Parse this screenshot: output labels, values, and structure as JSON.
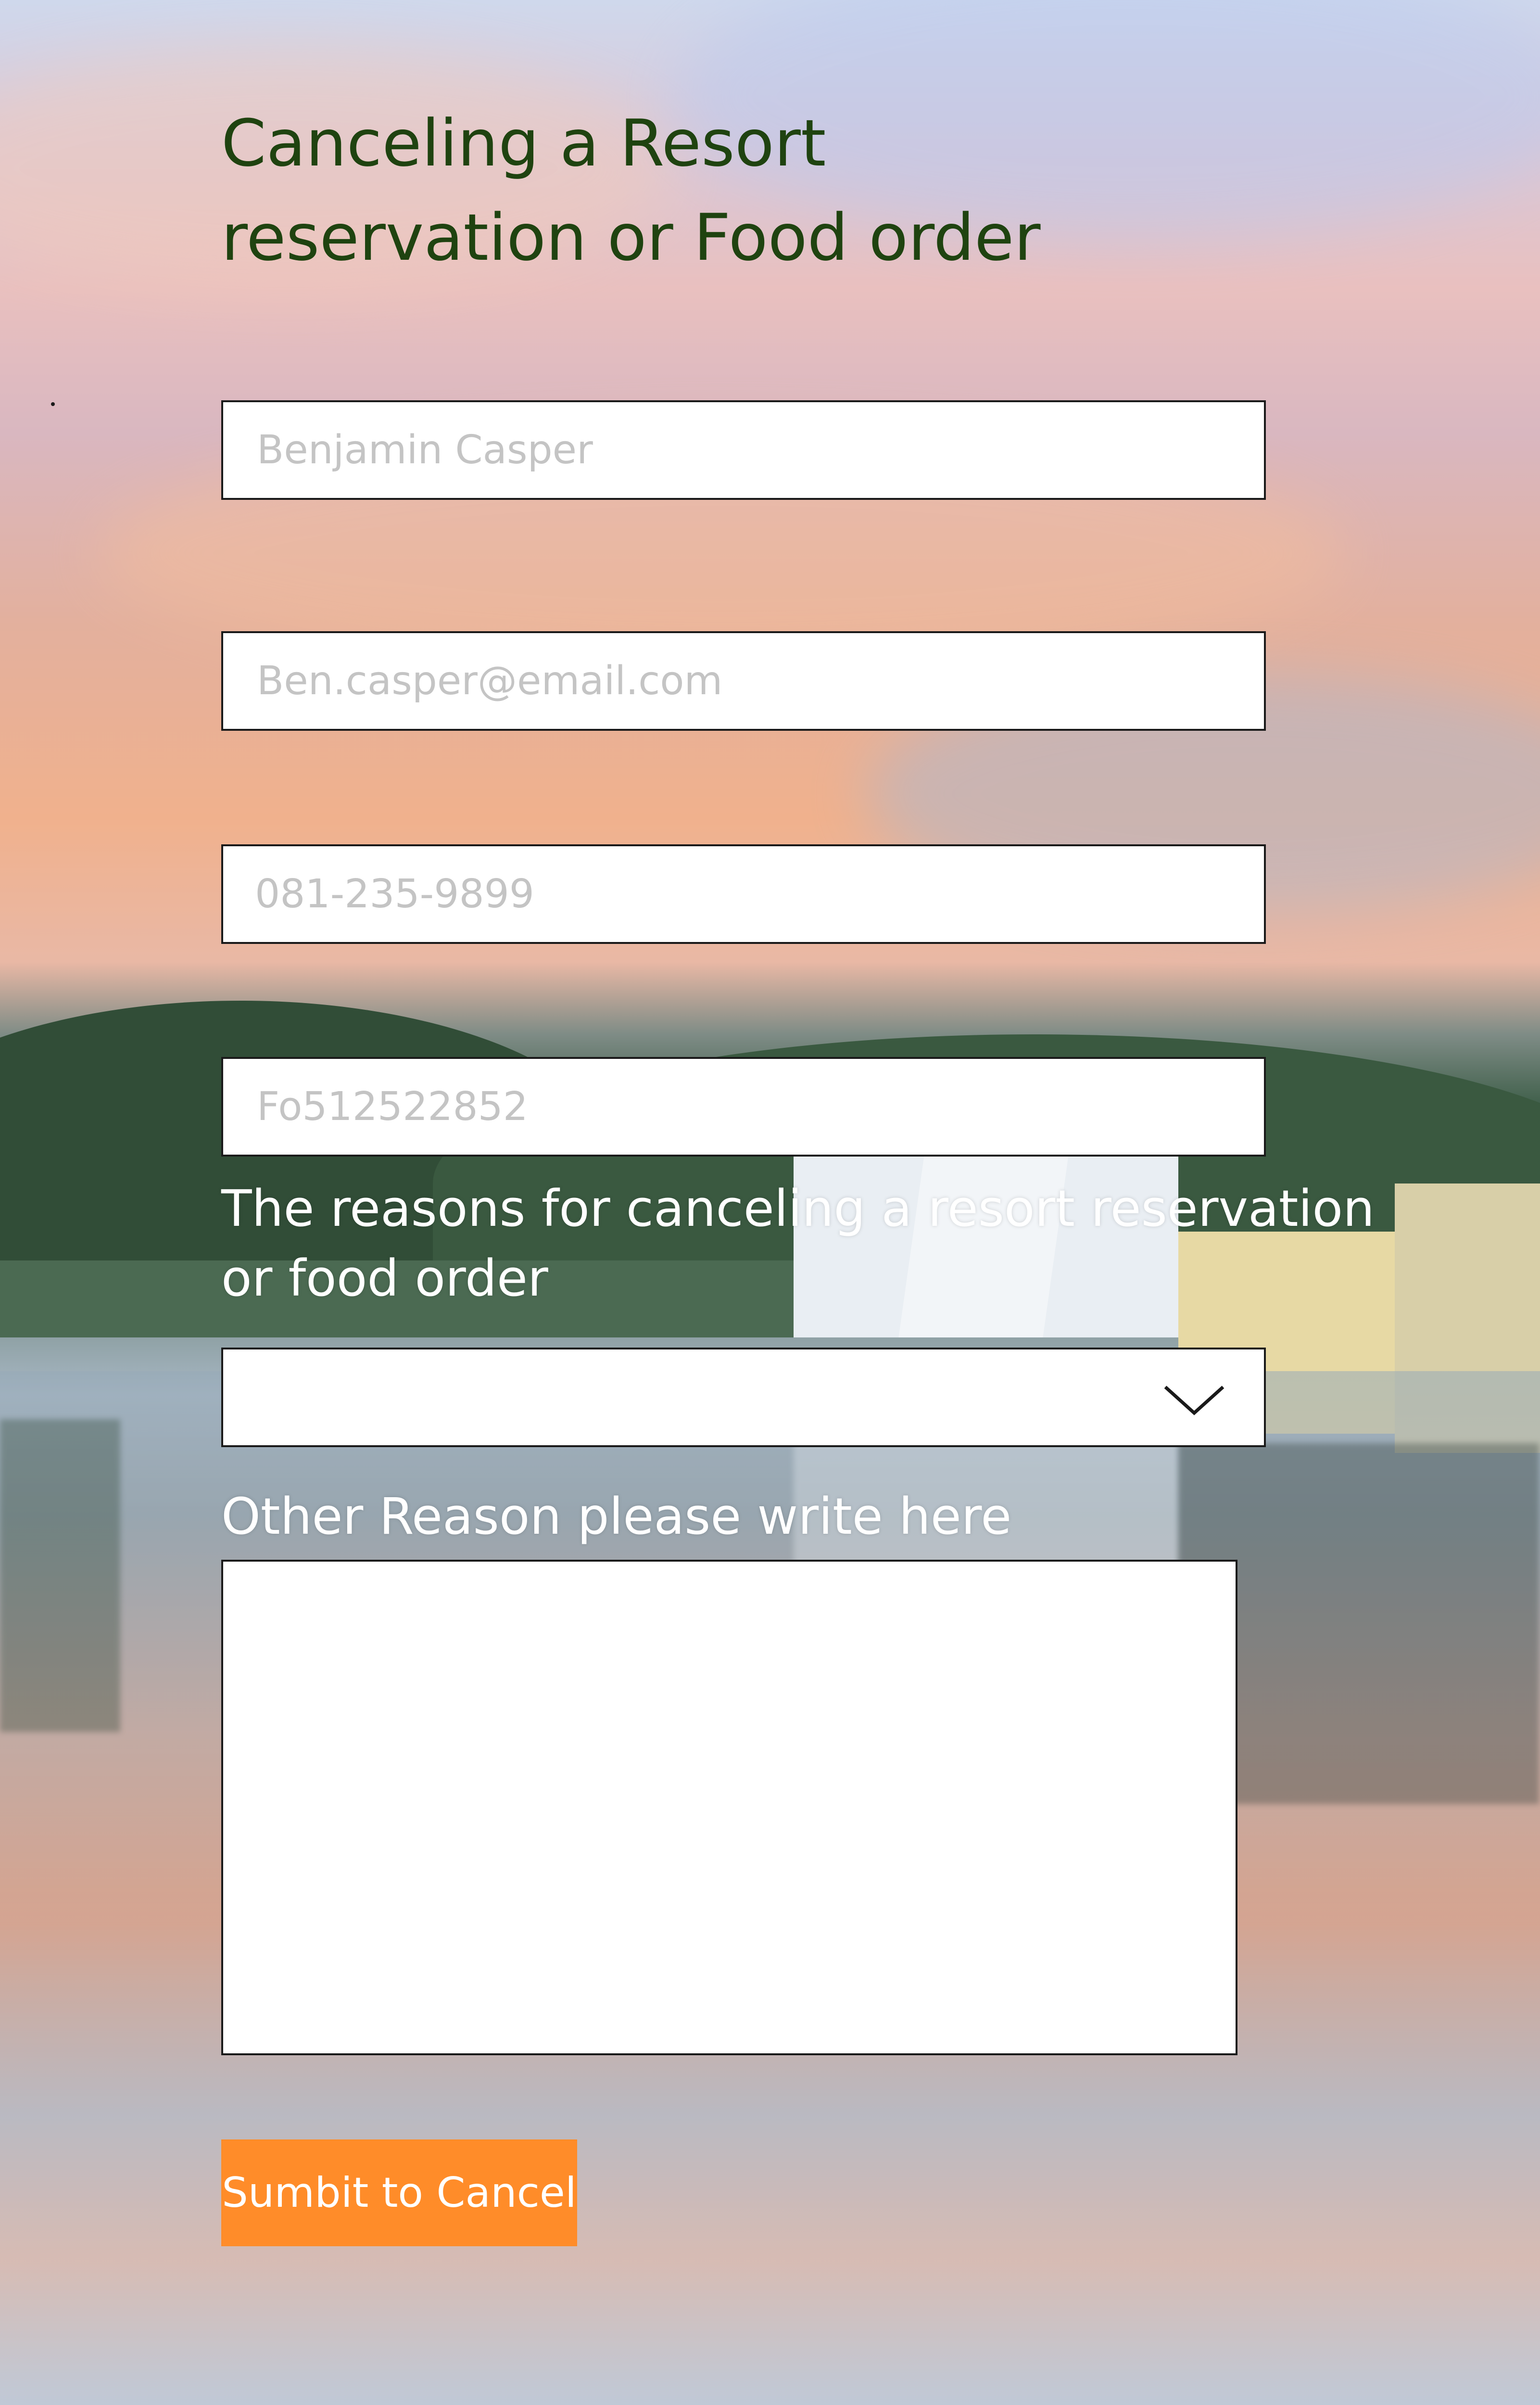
{
  "title": {
    "line1": "Canceling a Resort",
    "line2": "reservation or Food order"
  },
  "form": {
    "name_placeholder": "Benjamin Casper",
    "email_placeholder": "Ben.casper@email.com",
    "phone_placeholder": " 081-235-9899",
    "order_placeholder": "Fo512522852",
    "reason_label_line1": "The reasons for canceling a resort reservation",
    "reason_label_line2": "or food order",
    "reason_selected": "",
    "other_reason_label": "Other Reason please write here",
    "other_reason_value": "",
    "submit_label": "Sumbit to Cancel"
  },
  "colors": {
    "title": "#1f4310",
    "submit_bg": "#ff8c29",
    "label": "#ffffff"
  },
  "icons": {
    "dropdown": "chevron-down-icon"
  }
}
